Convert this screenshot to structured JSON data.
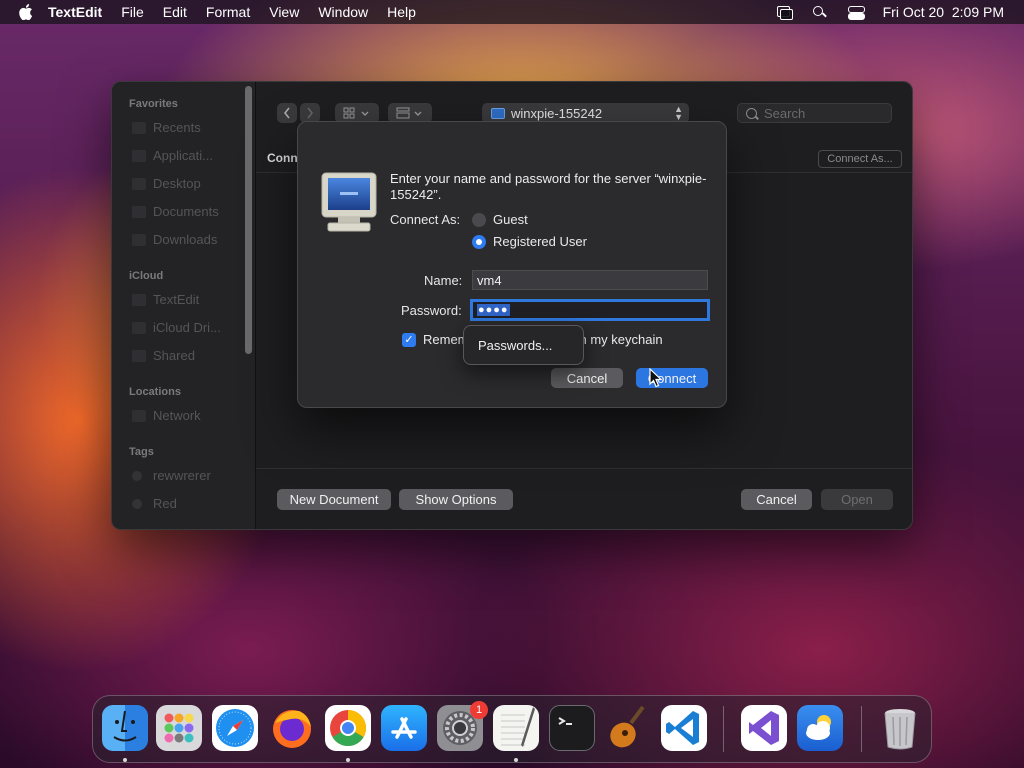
{
  "menubar": {
    "app_name": "TextEdit",
    "items": [
      "File",
      "Edit",
      "Format",
      "View",
      "Window",
      "Help"
    ],
    "clock": "Fri Oct 20  2:09 PM"
  },
  "sidebar": {
    "favorites_header": "Favorites",
    "favorites": [
      "Recents",
      "Applicati...",
      "Desktop",
      "Documents",
      "Downloads"
    ],
    "icloud_header": "iCloud",
    "icloud": [
      "TextEdit",
      "iCloud Dri...",
      "Shared"
    ],
    "locations_header": "Locations",
    "locations": [
      "Network"
    ],
    "tags_header": "Tags",
    "tags": [
      "rewwrerer",
      "Red"
    ]
  },
  "toolbar": {
    "path": "winxpie-155242",
    "search_placeholder": "Search"
  },
  "browser": {
    "conn_label": "Conn",
    "connect_as": "Connect As..."
  },
  "panel_buttons": {
    "new_document": "New Document",
    "show_options": "Show Options",
    "cancel": "Cancel",
    "open": "Open"
  },
  "dialog": {
    "message": "Enter your name and password for the server “winxpie-155242”.",
    "connect_as_label": "Connect As:",
    "guest": "Guest",
    "registered": "Registered User",
    "name_label": "Name:",
    "name_value": "vm4",
    "password_label": "Password:",
    "password_value": "●●●●",
    "remember_left": "Remem",
    "remember_right": "n my keychain",
    "cancel": "Cancel",
    "connect": "Connect"
  },
  "popup": {
    "item": "Passwords..."
  },
  "dock": {
    "settings_badge": "1"
  }
}
